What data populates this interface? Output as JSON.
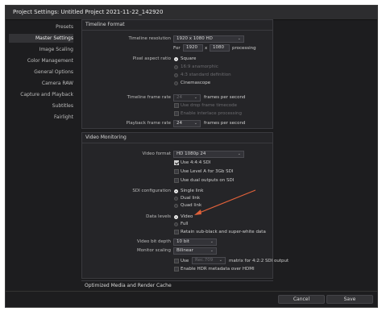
{
  "window": {
    "title": "Project Settings:  Untitled Project 2021-11-22_142920"
  },
  "sidebar": {
    "items": [
      {
        "label": "Presets"
      },
      {
        "label": "Master Settings"
      },
      {
        "label": "Image Scaling"
      },
      {
        "label": "Color Management"
      },
      {
        "label": "General Options"
      },
      {
        "label": "Camera RAW"
      },
      {
        "label": "Capture and Playback"
      },
      {
        "label": "Subtitles"
      },
      {
        "label": "Fairlight"
      }
    ],
    "active_index": 1
  },
  "timeline_format": {
    "section_title": "Timeline Format",
    "resolution_label": "Timeline resolution",
    "resolution_value": "1920 x 1080 HD",
    "for_label": "For",
    "width_value": "1920",
    "times_glyph": "x",
    "height_value": "1080",
    "processing_label": "processing",
    "par_label": "Pixel aspect ratio",
    "par_options": [
      "Square",
      "16:9 anamorphic",
      "4:3 standard definition",
      "Cinemascope"
    ],
    "par_selected": "Square",
    "frame_rate_label": "Timeline frame rate",
    "frame_rate_value": "24",
    "frame_rate_unit": "frames per second",
    "drop_frame_label": "Use drop frame timecode",
    "interlace_label": "Enable interlace processing",
    "playback_label": "Playback frame rate",
    "playback_value": "24",
    "playback_unit": "frames per second"
  },
  "video_monitoring": {
    "section_title": "Video Monitoring",
    "format_label": "Video format",
    "format_value": "HD 1080p 24",
    "use444_label": "Use 4:4:4 SDI",
    "use444_checked": true,
    "levelA_label": "Use Level A for 3Gb SDI",
    "dual_outputs_label": "Use dual outputs on SDI",
    "sdi_label": "SDI configuration",
    "sdi_options": [
      "Single link",
      "Dual link",
      "Quad link"
    ],
    "sdi_selected": "Single link",
    "data_levels_label": "Data levels",
    "data_levels_options": [
      "Video",
      "Full"
    ],
    "data_levels_selected": "Video",
    "retain_label": "Retain sub-black and super-white data",
    "bit_depth_label": "Video bit depth",
    "bit_depth_value": "10 bit",
    "scaling_label": "Monitor scaling",
    "scaling_value": "Bilinear",
    "use_label": "Use",
    "matrix_value": "Rec.709",
    "matrix_suffix": "matrix for 4:2:2 SDI output",
    "hdr_label": "Enable HDR metadata over HDMI"
  },
  "next_section_title": "Optimized Media and Render Cache",
  "footer": {
    "cancel_label": "Cancel",
    "save_label": "Save"
  },
  "annotation": {
    "color": "#e0613a"
  }
}
